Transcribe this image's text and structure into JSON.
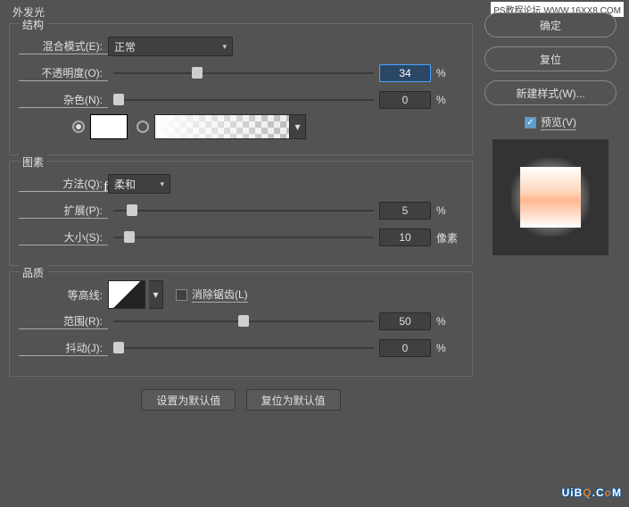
{
  "watermark": "PS教程论坛 WWW.16XX8.COM",
  "title": "外发光",
  "sections": {
    "structure": {
      "legend": "结构",
      "blend_mode_label": "混合模式(E):",
      "blend_mode_value": "正常",
      "opacity_label": "不透明度(O):",
      "opacity_value": "34",
      "opacity_unit": "%",
      "noise_label": "杂色(N):",
      "noise_value": "0",
      "noise_unit": "%",
      "color_note": "ffffff"
    },
    "elements": {
      "legend": "图素",
      "method_label": "方法(Q):",
      "method_value": "柔和",
      "spread_label": "扩展(P):",
      "spread_value": "5",
      "spread_unit": "%",
      "size_label": "大小(S):",
      "size_value": "10",
      "size_unit": "像素"
    },
    "quality": {
      "legend": "品质",
      "contour_label": "等高线:",
      "antialias_label": "消除锯齿(L)",
      "range_label": "范围(R):",
      "range_value": "50",
      "range_unit": "%",
      "jitter_label": "抖动(J):",
      "jitter_value": "0",
      "jitter_unit": "%"
    }
  },
  "buttons": {
    "default": "设置为默认值",
    "reset_default": "复位为默认值",
    "ok": "确定",
    "reset": "复位",
    "new_style": "新建样式(W)...",
    "preview": "预览(V)"
  },
  "logo": {
    "a": "UiB",
    "b": "Q",
    ".c": "C",
    "d": "o",
    "e": "M"
  }
}
